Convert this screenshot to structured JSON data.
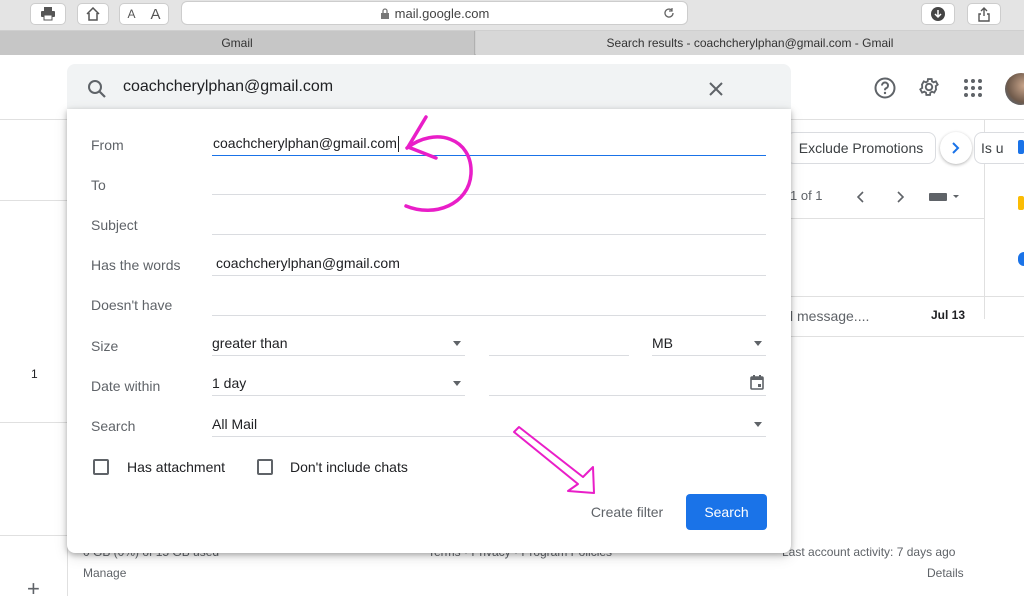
{
  "browser": {
    "address": "mail.google.com",
    "font_small": "A",
    "font_large": "A",
    "tabs": [
      "Gmail",
      "Search results - coachcherylphan@gmail.com - Gmail"
    ]
  },
  "search": {
    "query": "coachcherylphan@gmail.com"
  },
  "dialog": {
    "fields": {
      "from_label": "From",
      "from_value": "coachcherylphan@gmail.com",
      "to_label": "To",
      "to_value": "",
      "subject_label": "Subject",
      "subject_value": "",
      "has_words_label": "Has the words",
      "has_words_value": "coachcherylphan@gmail.com",
      "doesnt_have_label": "Doesn't have",
      "doesnt_have_value": "",
      "size_label": "Size",
      "size_op": "greater than",
      "size_unit": "MB",
      "date_label": "Date within",
      "date_range": "1 day",
      "search_label": "Search",
      "search_scope": "All Mail"
    },
    "checkboxes": {
      "has_attachment": "Has attachment",
      "no_chats": "Don't include chats"
    },
    "create_filter": "Create filter",
    "search_button": "Search"
  },
  "background": {
    "chip_promotions": "Exclude Promotions",
    "chip_partial": "Is u",
    "pager": "1 of 1",
    "row_snippet": "l message....",
    "row_date": "Jul 13",
    "left_count": "1",
    "footer_storage": "0 GB (0%) of 15 GB used",
    "footer_manage": "Manage",
    "footer_links": "Terms · Privacy · Program Policies",
    "footer_activity": "Last account activity: 7 days ago",
    "footer_details": "Details"
  },
  "colors": {
    "accent": "#1a73e8",
    "annotation": "#e91ec8"
  }
}
